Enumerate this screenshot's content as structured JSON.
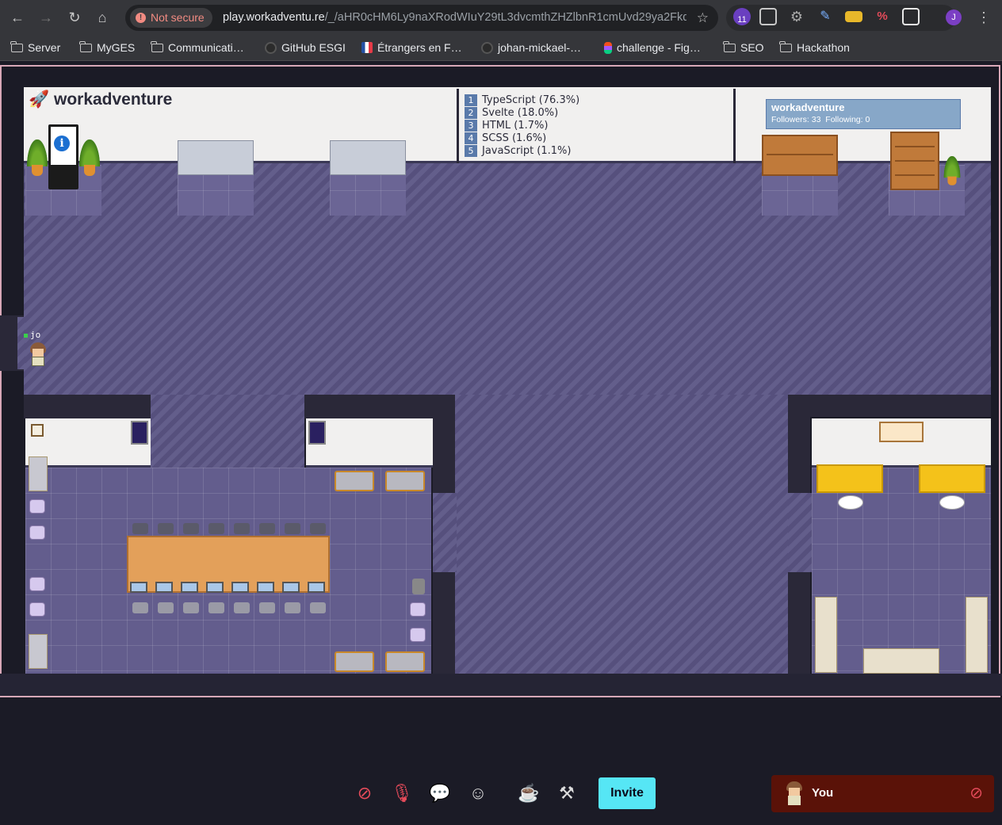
{
  "browser": {
    "security_label": "Not secure",
    "url_host": "play.workadventu.re",
    "url_path": "/_/aHR0cHM6Ly9naXRodWIuY29tL3dvcmthZHZlbnR1cmUvd29ya2Fkd…",
    "extension_badge": "11",
    "profile_initial": "J"
  },
  "bookmarks": [
    {
      "label": "Server",
      "icon": "folder-icon"
    },
    {
      "label": "MyGES",
      "icon": "folder-icon"
    },
    {
      "label": "Communicati…",
      "icon": "folder-icon"
    },
    {
      "label": "GitHub ESGI",
      "icon": "github-icon"
    },
    {
      "label": "Étrangers en F…",
      "icon": "flag-icon"
    },
    {
      "label": "johan-mickael-…",
      "icon": "github-icon"
    },
    {
      "label": "challenge - Fig…",
      "icon": "figma-icon"
    },
    {
      "label": "SEO",
      "icon": "folder-icon"
    },
    {
      "label": "Hackathon",
      "icon": "folder-icon"
    }
  ],
  "game": {
    "logo_text": "workadventure",
    "languages": [
      {
        "rank": "1",
        "label": "TypeScript (76.3%)"
      },
      {
        "rank": "2",
        "label": "Svelte (18.0%)"
      },
      {
        "rank": "3",
        "label": "HTML (1.7%)"
      },
      {
        "rank": "4",
        "label": "SCSS (1.6%)"
      },
      {
        "rank": "5",
        "label": "JavaScript (1.1%)"
      }
    ],
    "github_card": {
      "title": "workadventure",
      "followers": "Followers: 33",
      "following": "Following: 0"
    },
    "player_name": "jo"
  },
  "toolbar": {
    "invite_label": "Invite",
    "you_label": "You"
  },
  "colors": {
    "floor": "#5b5585",
    "invite": "#56e6f5",
    "you_card": "#5a1208",
    "muted": "#e54b5a"
  }
}
